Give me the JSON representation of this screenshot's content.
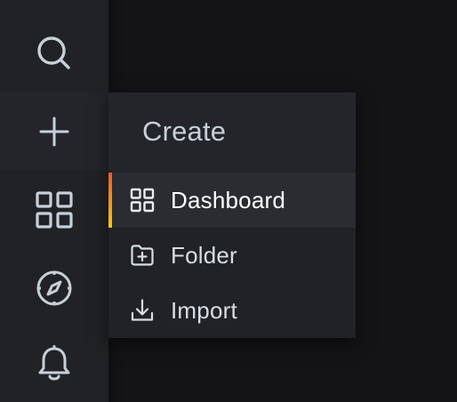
{
  "sidebar": {
    "items": [
      {
        "icon": "search-icon"
      },
      {
        "icon": "plus-icon",
        "active": true
      },
      {
        "icon": "apps-icon"
      },
      {
        "icon": "compass-icon"
      },
      {
        "icon": "bell-icon"
      }
    ]
  },
  "create_menu": {
    "title": "Create",
    "items": [
      {
        "label": "Dashboard",
        "icon": "apps-icon",
        "active": true
      },
      {
        "label": "Folder",
        "icon": "folder-plus-icon"
      },
      {
        "label": "Import",
        "icon": "import-icon"
      }
    ]
  },
  "colors": {
    "sidebar_bg": "#202226",
    "page_bg": "#141417",
    "accent_top": "#f05a28",
    "accent_bottom": "#fbca0a",
    "text": "#c7d0d9"
  }
}
